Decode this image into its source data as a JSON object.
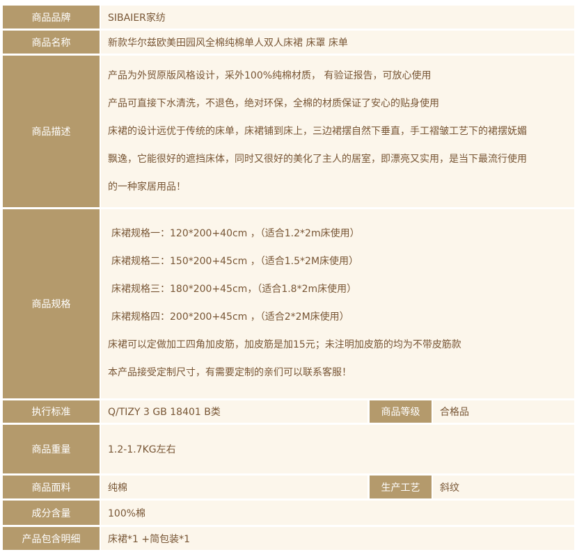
{
  "colors": {
    "label_bg": "#b49a6c",
    "value_bg": "#fcf6eb",
    "label_text": "#ffffff",
    "value_text": "#775534"
  },
  "brand": {
    "label": "商品品牌",
    "value": "SIBAIER家纺"
  },
  "name": {
    "label": "商品名称",
    "value": "新款华尔兹欧美田园风全棉纯棉单人双人床裙 床罩 床单"
  },
  "description": {
    "label": "商品描述",
    "lines": [
      "产品为外贸原版风格设计，采外100%纯棉材质， 有验证报告，可放心使用",
      "产品可直接下水清洗，不退色，绝对环保，全棉的材质保证了安心的贴身使用",
      "床裙的设计远优于传统的床单，床裙铺到床上，三边裙摆自然下垂直，手工褶皱工艺下的裙摆妩媚",
      "飘逸，它能很好的遮挡床体，同时又很好的美化了主人的居室，即漂亮又实用，是当下最流行使用",
      "的一种家居用品！"
    ]
  },
  "specs": {
    "label": "商品规格",
    "lines": [
      "床裙规格一：120*200+40cm ，（适合1.2*2m床使用）",
      "床裙规格二：150*200+45cm ，（适合1.5*2M床使用）",
      "床裙规格三：180*200+45cm，（适合1.8*2m床使用）",
      "床裙规格四：200*200+45cm  ，（适合2*2M床使用）",
      "床裙可以定做加工四角加皮筋，加皮筋是加15元；未注明加皮筋的均为不带皮筋款",
      "本产品接受定制尺寸，有需要定制的亲们可以联系客服！"
    ]
  },
  "standard": {
    "label": "执行标准",
    "value": "Q/TIZY 3 GB 18401 B类"
  },
  "grade": {
    "label": "商品等级",
    "value": "合格品"
  },
  "weight": {
    "label": "商品重量",
    "value": "1.2-1.7KG左右"
  },
  "fabric": {
    "label": "商品面料",
    "value": "纯棉"
  },
  "process": {
    "label": "生产工艺",
    "value": "斜纹"
  },
  "content": {
    "label": "成分含量",
    "value": "100%棉"
  },
  "package": {
    "label": "产品包含明细",
    "value": "床裙*1 +简包装*1"
  }
}
